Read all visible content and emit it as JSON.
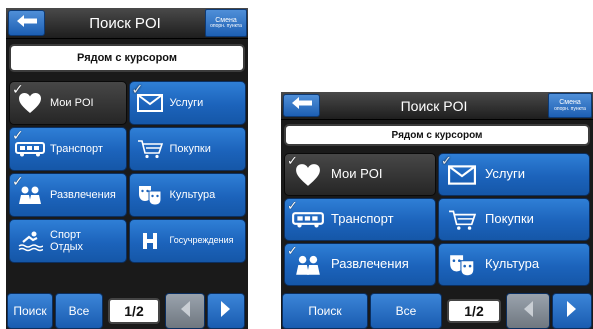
{
  "screens": [
    {
      "header": {
        "title": "Поиск POI",
        "change_label_line1": "Смена",
        "change_label_line2": "опорн. пункта",
        "back_icon": "arrow-left-icon"
      },
      "near_cursor_label": "Рядом с курсором",
      "categories": [
        {
          "label": "Мои POI",
          "icon": "heart-icon",
          "checked": true,
          "selected": true
        },
        {
          "label": "Услуги",
          "icon": "envelope-icon",
          "checked": true,
          "selected": false
        },
        {
          "label": "Транспорт",
          "icon": "bus-icon",
          "checked": true,
          "selected": false
        },
        {
          "label": "Покупки",
          "icon": "shopping-cart-icon",
          "checked": false,
          "selected": false
        },
        {
          "label": "Развлечения",
          "icon": "people-icon",
          "checked": true,
          "selected": false
        },
        {
          "label": "Культура",
          "icon": "theater-masks-icon",
          "checked": false,
          "selected": false
        },
        {
          "label": "Спорт\nОтдых",
          "icon": "swimmer-icon",
          "checked": false,
          "selected": false
        },
        {
          "label": "Госучреждения",
          "icon": "hospital-h-icon",
          "checked": false,
          "selected": false
        }
      ],
      "bottom": {
        "search_label": "Поиск",
        "all_label": "Все",
        "page_indicator": "1/2",
        "prev_icon": "arrow-left-icon",
        "next_icon": "arrow-right-icon"
      }
    },
    {
      "header": {
        "title": "Поиск POI",
        "change_label_line1": "Смена",
        "change_label_line2": "опорн. пункта",
        "back_icon": "arrow-left-icon"
      },
      "near_cursor_label": "Рядом с курсором",
      "categories": [
        {
          "label": "Мои POI",
          "icon": "heart-icon",
          "checked": true,
          "selected": true
        },
        {
          "label": "Услуги",
          "icon": "envelope-icon",
          "checked": true,
          "selected": false
        },
        {
          "label": "Транспорт",
          "icon": "bus-icon",
          "checked": true,
          "selected": false
        },
        {
          "label": "Покупки",
          "icon": "shopping-cart-icon",
          "checked": false,
          "selected": false
        },
        {
          "label": "Развлечения",
          "icon": "people-icon",
          "checked": true,
          "selected": false
        },
        {
          "label": "Культура",
          "icon": "theater-masks-icon",
          "checked": false,
          "selected": false
        }
      ],
      "bottom": {
        "search_label": "Поиск",
        "all_label": "Все",
        "page_indicator": "1/2",
        "prev_icon": "arrow-left-icon",
        "next_icon": "arrow-right-icon"
      }
    }
  ],
  "colors": {
    "button_blue": "#1c63bb",
    "selected_dark": "#2e2e2e",
    "header_dark": "#2a2a2a",
    "disabled_grey": "#8a929b"
  }
}
